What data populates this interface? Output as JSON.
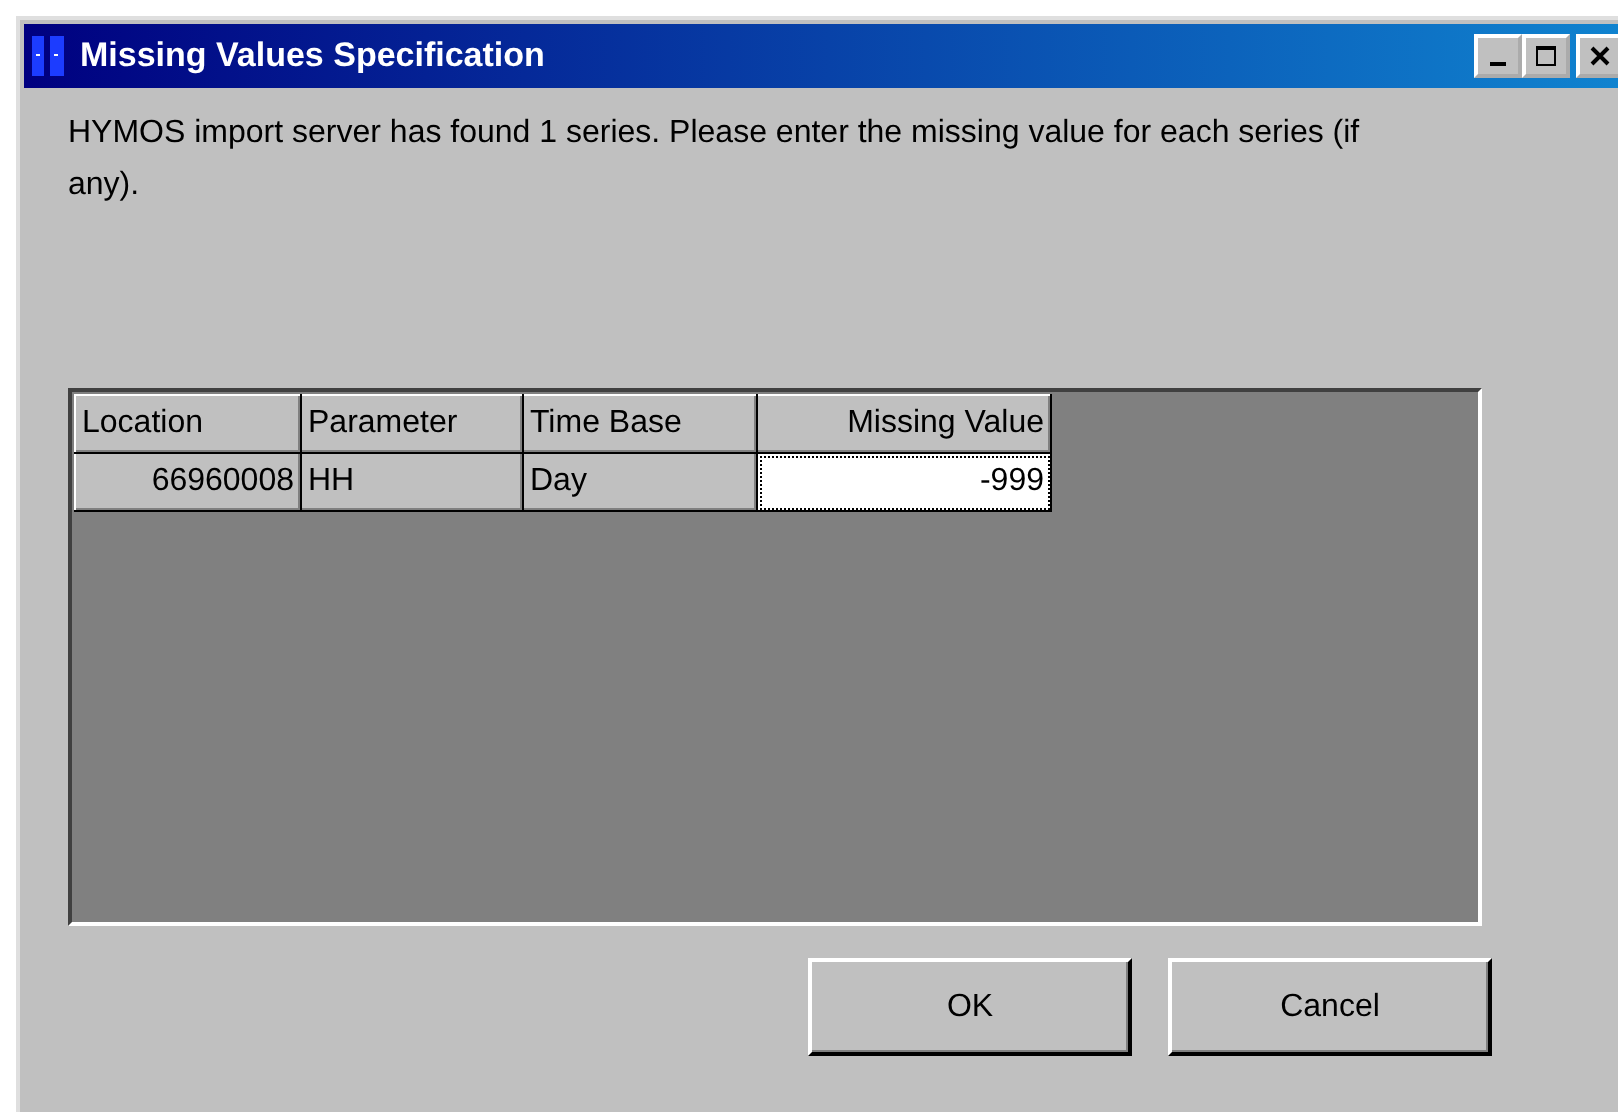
{
  "window": {
    "title": "Missing Values Specification"
  },
  "message": "HYMOS import server has found 1 series. Please enter the missing value for each series (if any).",
  "table": {
    "columns": [
      "Location",
      "Parameter",
      "Time Base",
      "Missing Value"
    ],
    "rows": [
      {
        "cells": [
          {
            "kind": "text",
            "value": "66960008"
          },
          {
            "kind": "text",
            "value": "HH"
          },
          {
            "kind": "text",
            "value": "Day"
          },
          {
            "kind": "edit",
            "value": "-999"
          }
        ]
      }
    ]
  },
  "buttons": [
    "OK",
    "Cancel"
  ]
}
